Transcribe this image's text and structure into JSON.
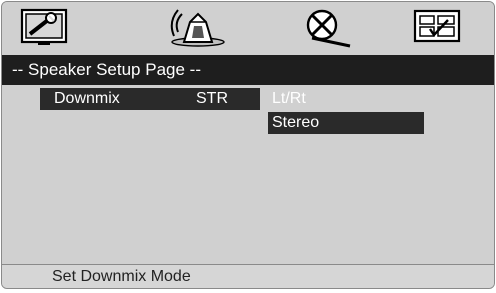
{
  "icons": [
    {
      "name": "general-setup-icon"
    },
    {
      "name": "speaker-setup-icon"
    },
    {
      "name": "dolby-digital-setup-icon"
    },
    {
      "name": "preference-setup-icon"
    }
  ],
  "title": "--  Speaker Setup Page  --",
  "menu": {
    "label": "Downmix",
    "value": "STR"
  },
  "options": [
    "Lt/Rt",
    "Stereo"
  ],
  "selected_option": "Stereo",
  "status": "Set Downmix Mode",
  "colors": {
    "background": "#d0d0d0",
    "highlight": "#2a2a2a",
    "title_bar": "#1e1e1e"
  }
}
